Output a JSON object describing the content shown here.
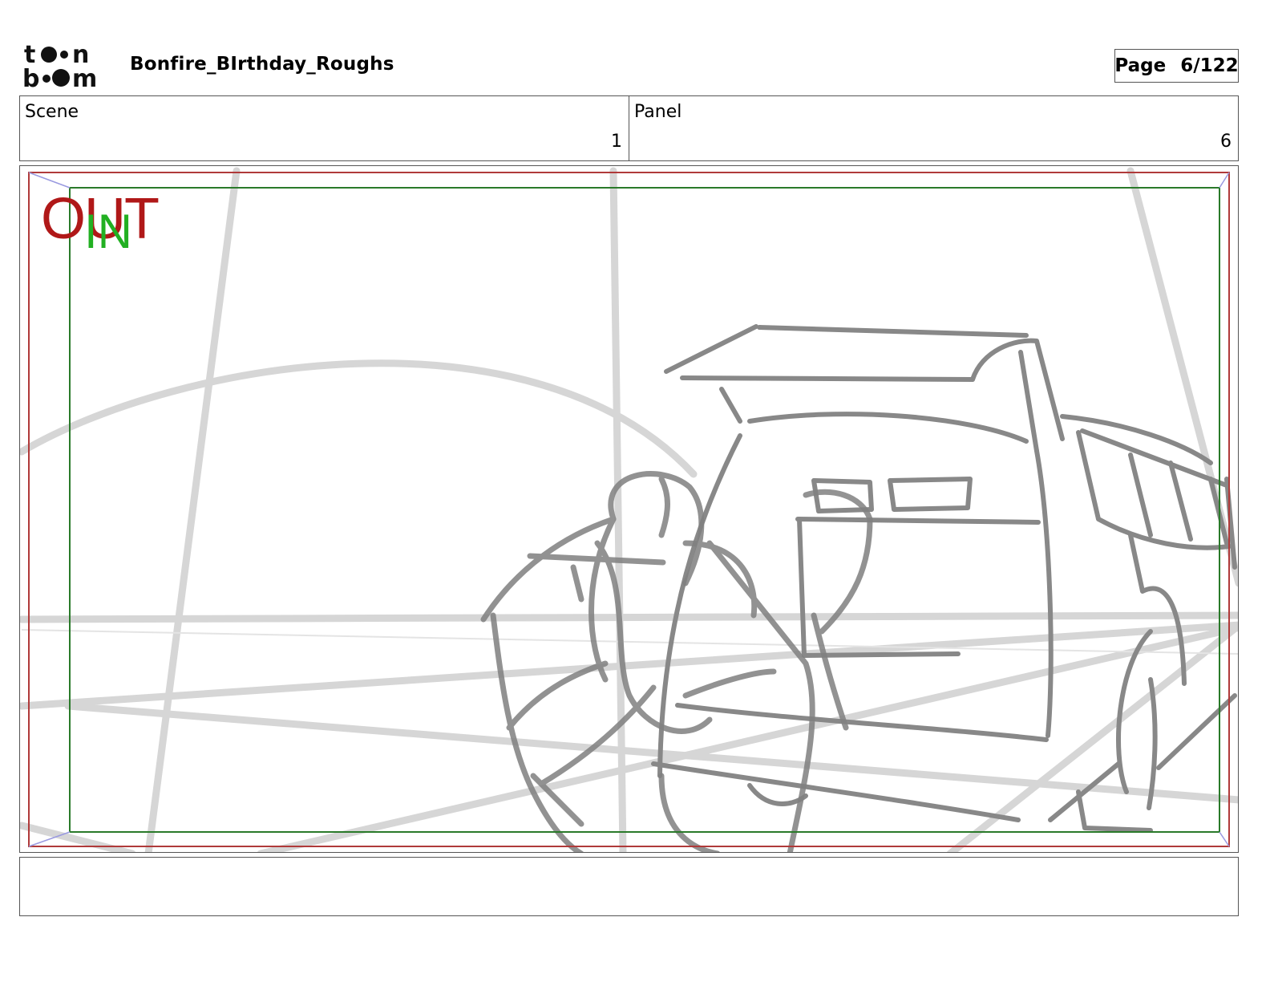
{
  "header": {
    "logo_text": "toon boom",
    "project_title": "Bonfire_BIrthday_Roughs",
    "page_label": "Page",
    "page_value": "6/122"
  },
  "info": {
    "scene_label": "Scene",
    "scene_value": "1",
    "panel_label": "Panel",
    "panel_value": "6"
  },
  "frame": {
    "out_label": "OUT",
    "in_label": "IN",
    "out_color": "#b01818",
    "in_color": "#22b022",
    "safe_frame_color": "#2a7a2a",
    "camera_frame_color": "#b03a3a",
    "sketch_color": "#7a7a7a",
    "guide_color": "#cccccc"
  },
  "notes": {
    "text": ""
  }
}
